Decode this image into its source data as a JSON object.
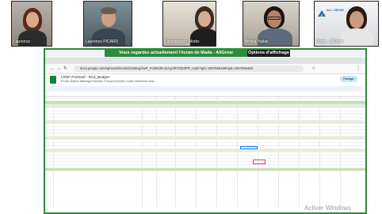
{
  "participants": [
    {
      "name": "Laurence"
    },
    {
      "name": "Laurence PICARD"
    },
    {
      "name": "Designathon Works"
    },
    {
      "name": "Mihika Yadav"
    },
    {
      "name": "Mada - AllGrow"
    }
  ],
  "logo_text": "ALL GROW",
  "banner": {
    "message": "Vous regardez actuellement l'écran de  Mada - AllGrow",
    "options_label": "Options d'affichage"
  },
  "browser": {
    "url": "docs.google.com/spreadsheets/d/1D5sqyXwP_FGBM4hcSd-go3hTEEZPR_rsd4/?gid=1907696469#gid=1907696469"
  },
  "sheet": {
    "title": "LRDF Portneuf - RA2_Budget",
    "menu": "Fichier  Édition  Affichage  Insertion  Format  Données  Outils  Extensions  Aide",
    "share_label": "Partager"
  },
  "watermark": "Activer Windows"
}
